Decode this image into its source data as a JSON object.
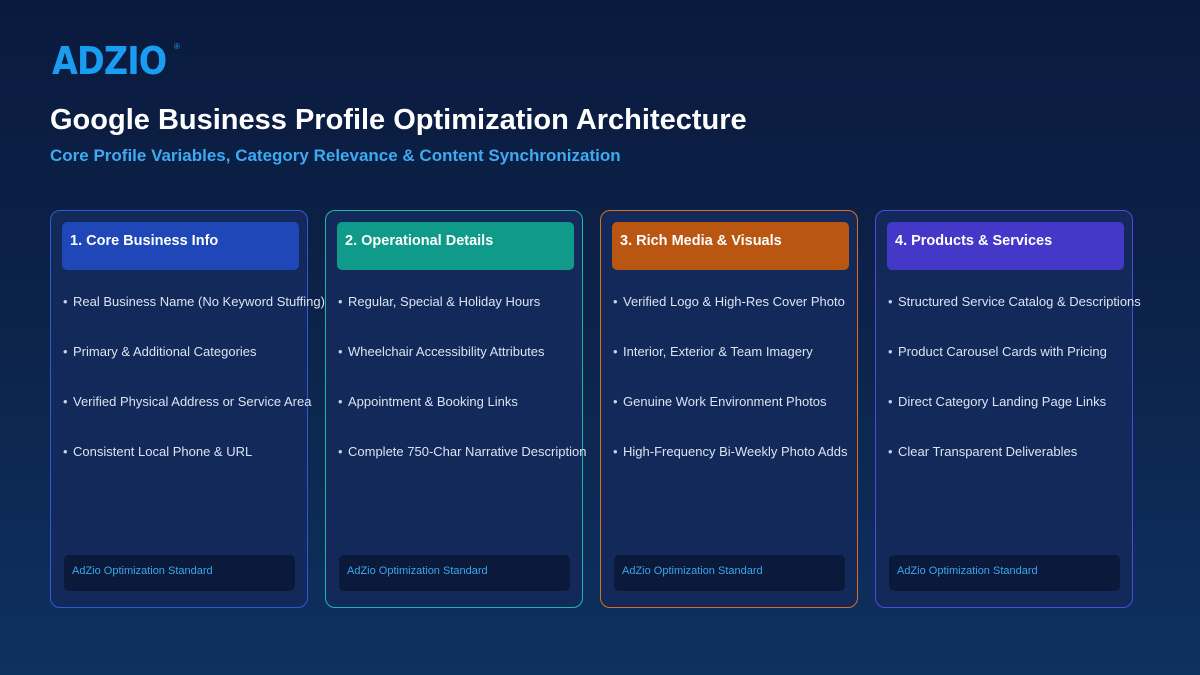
{
  "brand": {
    "logo_text": "ADZIO",
    "registered_mark": "®"
  },
  "header": {
    "title": "Google Business Profile Optimization Architecture",
    "subtitle": "Core Profile Variables, Category Relevance & Content Synchronization"
  },
  "colors": {
    "background": "#0c2248",
    "card_background": "#12295a",
    "accent_blue": "#3eaaf2",
    "card_1": "#1f47b8",
    "card_2": "#0f9a8a",
    "card_3": "#b85612",
    "card_4": "#4338c8"
  },
  "cards": [
    {
      "title": "1. Core Business Info",
      "items": [
        "Real Business Name (No Keyword Stuffing)",
        "Primary & Additional Categories",
        "Verified Physical Address or Service Area",
        "Consistent Local Phone & URL"
      ],
      "footer": "AdZio Optimization Standard"
    },
    {
      "title": "2. Operational Details",
      "items": [
        "Regular, Special & Holiday Hours",
        "Wheelchair Accessibility Attributes",
        "Appointment & Booking Links",
        "Complete 750-Char Narrative Description"
      ],
      "footer": "AdZio Optimization Standard"
    },
    {
      "title": "3. Rich Media & Visuals",
      "items": [
        "Verified Logo & High-Res Cover Photo",
        "Interior, Exterior & Team Imagery",
        "Genuine Work Environment Photos",
        "High-Frequency Bi-Weekly Photo Adds"
      ],
      "footer": "AdZio Optimization Standard"
    },
    {
      "title": "4. Products & Services",
      "items": [
        "Structured Service Catalog & Descriptions",
        "Product Carousel Cards with Pricing",
        "Direct Category Landing Page Links",
        "Clear Transparent Deliverables"
      ],
      "footer": "AdZio Optimization Standard"
    }
  ]
}
